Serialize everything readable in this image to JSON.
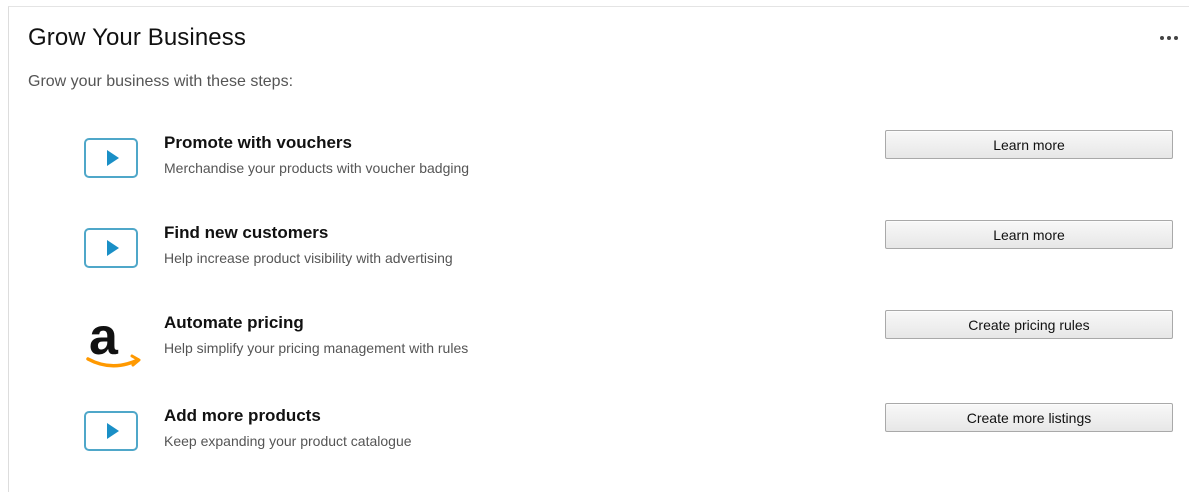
{
  "header": {
    "title": "Grow Your Business",
    "more_icon": "ellipsis-horizontal-icon"
  },
  "subtitle": "Grow your business with these steps:",
  "steps": [
    {
      "icon": "play-video-icon",
      "title": "Promote with vouchers",
      "description": "Merchandise your products with voucher badging",
      "button_label": "Learn more"
    },
    {
      "icon": "play-video-icon",
      "title": "Find new customers",
      "description": "Help increase product visibility with advertising",
      "button_label": "Learn more"
    },
    {
      "icon": "amazon-logo-icon",
      "title": "Automate pricing",
      "description": "Help simplify your pricing management with rules",
      "button_label": "Create pricing rules"
    },
    {
      "icon": "play-video-icon",
      "title": "Add more products",
      "description": "Keep expanding your product catalogue",
      "button_label": "Create more listings"
    }
  ],
  "colors": {
    "play_icon_border": "#4fa7c9",
    "play_icon_fill": "#1a8fc6",
    "amazon_smile": "#ff9900"
  }
}
